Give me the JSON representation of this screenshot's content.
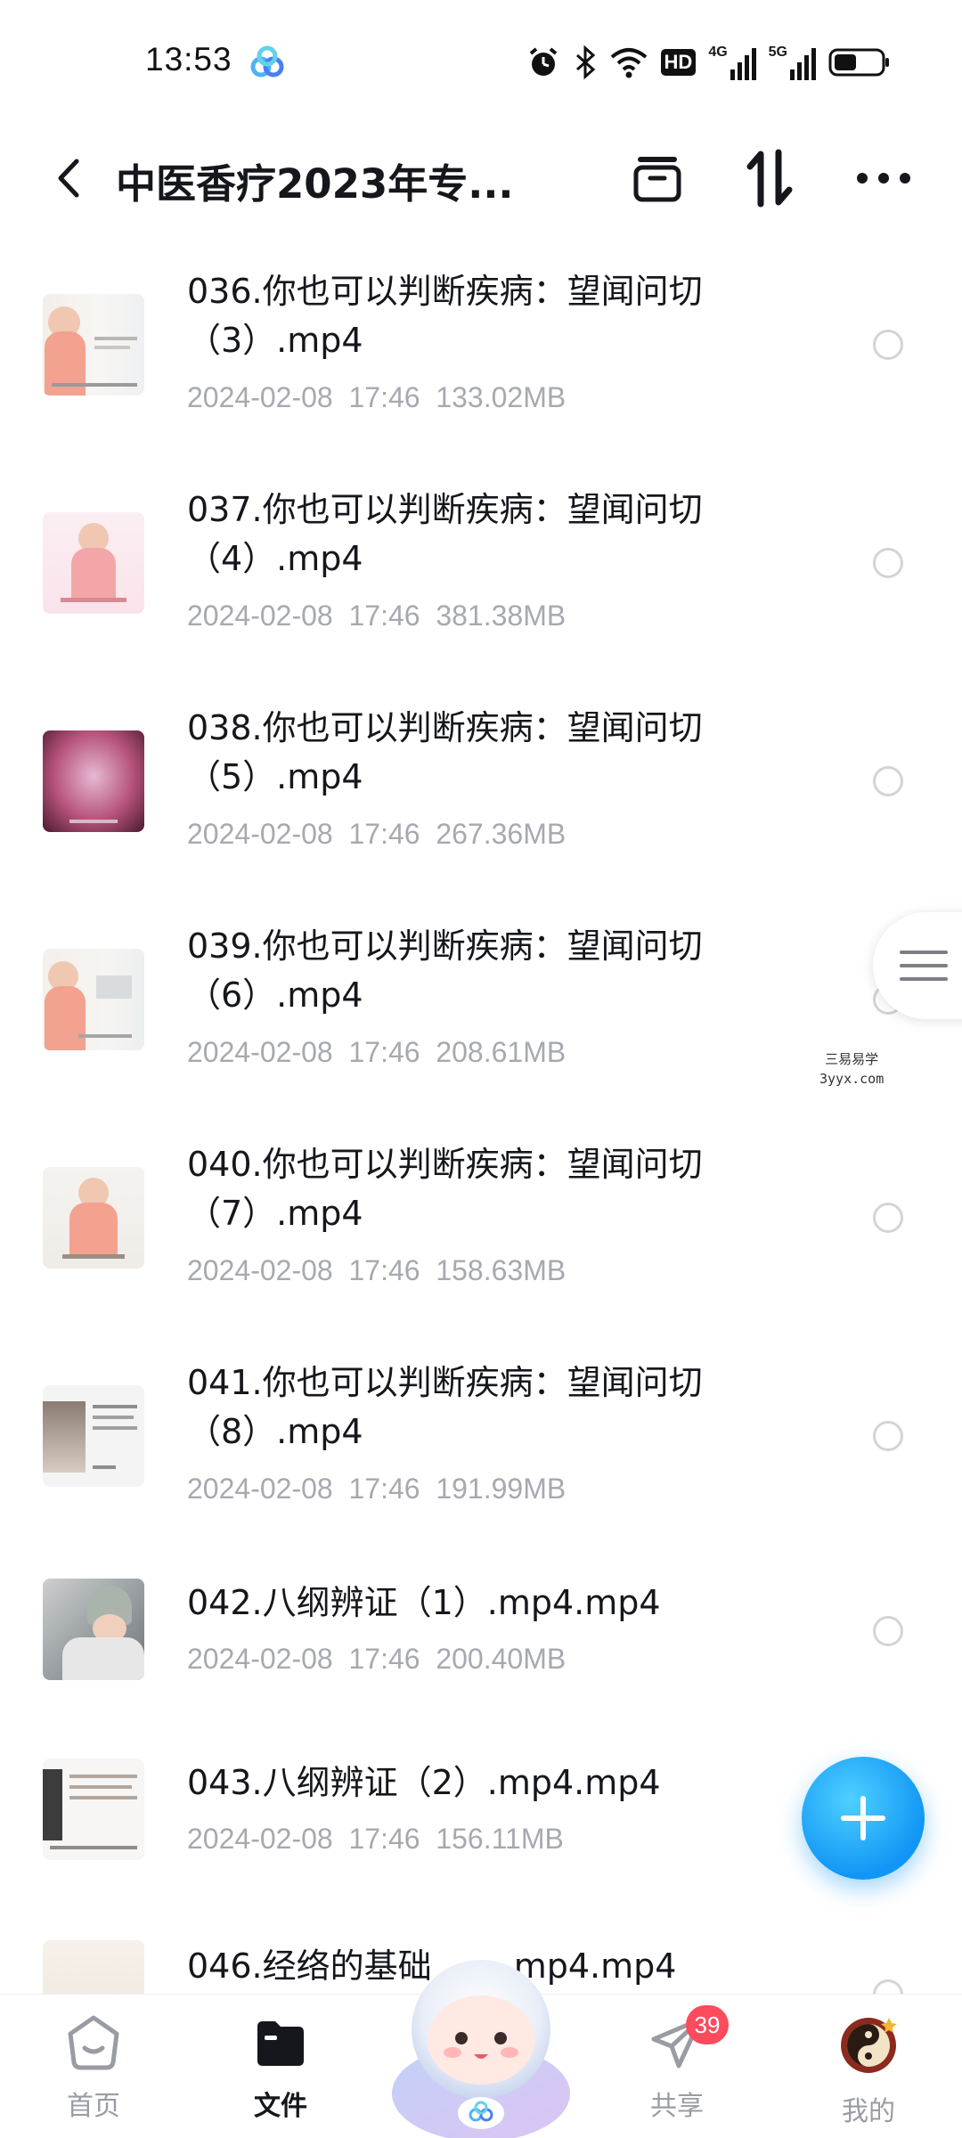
{
  "status_bar": {
    "time": "13:53",
    "icons": [
      "alarm-icon",
      "bluetooth-icon",
      "wifi-icon",
      "hd-icon",
      "signal-4g-icon",
      "signal-5g-icon",
      "battery-icon"
    ],
    "hd_label": "HD",
    "net1": "4G",
    "net2": "5G"
  },
  "header": {
    "title": "中医香疗2023年专...",
    "actions": [
      "archive-icon",
      "sort-icon",
      "more-icon"
    ]
  },
  "files": [
    {
      "name": "036.你也可以判断疾病：望闻问切（3）.mp4",
      "date": "2024-02-08",
      "time": "17:46",
      "size": "133.02MB"
    },
    {
      "name": "037.你也可以判断疾病：望闻问切（4）.mp4",
      "date": "2024-02-08",
      "time": "17:46",
      "size": "381.38MB"
    },
    {
      "name": "038.你也可以判断疾病：望闻问切（5）.mp4",
      "date": "2024-02-08",
      "time": "17:46",
      "size": "267.36MB"
    },
    {
      "name": "039.你也可以判断疾病：望闻问切（6）.mp4",
      "date": "2024-02-08",
      "time": "17:46",
      "size": "208.61MB"
    },
    {
      "name": "040.你也可以判断疾病：望闻问切（7）.mp4",
      "date": "2024-02-08",
      "time": "17:46",
      "size": "158.63MB"
    },
    {
      "name": "041.你也可以判断疾病：望闻问切（8）.mp4",
      "date": "2024-02-08",
      "time": "17:46",
      "size": "191.99MB"
    },
    {
      "name": "042.八纲辨证（1）.mp4.mp4",
      "date": "2024-02-08",
      "time": "17:46",
      "size": "200.40MB"
    },
    {
      "name": "043.八纲辨证（2）.mp4.mp4",
      "date": "2024-02-08",
      "time": "17:46",
      "size": "156.11MB"
    },
    {
      "name": "046.经络的基础",
      "name_tail": ".mp4.mp4",
      "date": "",
      "time": "",
      "size": ""
    }
  ],
  "watermark": {
    "line1": "三易易学",
    "line2": "3yyx.com"
  },
  "colors": {
    "accent": "#1196f5",
    "badge": "#fb4b5d",
    "meta": "#a7a9b0"
  },
  "bottom_nav": {
    "items": [
      {
        "label": "首页",
        "icon": "home-icon"
      },
      {
        "label": "文件",
        "icon": "folder-icon"
      },
      {
        "label": "共享",
        "icon": "share-icon",
        "badge": "39"
      },
      {
        "label": "我的",
        "icon": "avatar"
      }
    ]
  }
}
